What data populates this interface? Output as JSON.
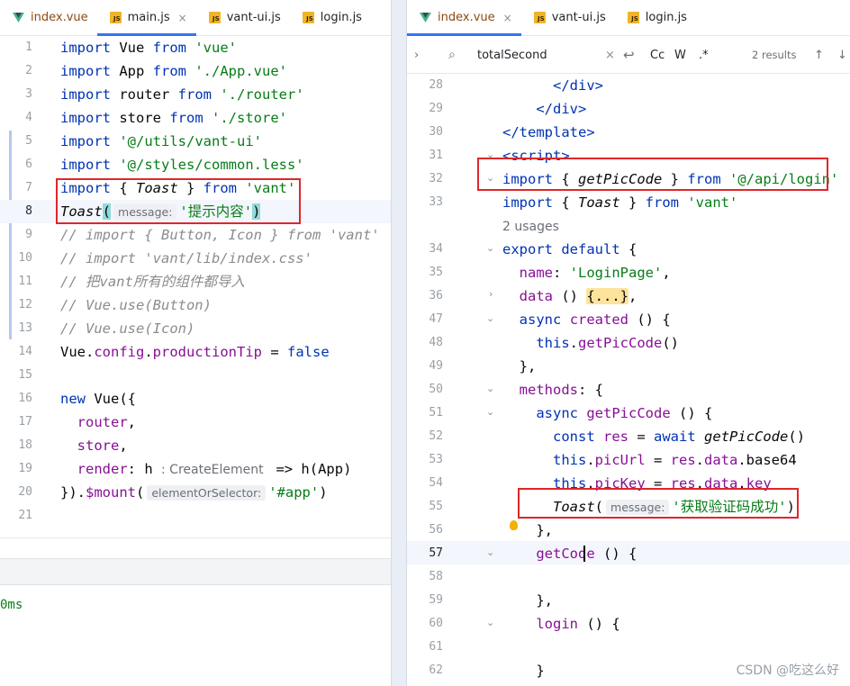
{
  "left": {
    "tabs": [
      {
        "label": "index.vue",
        "type": "vue",
        "active": false,
        "closable": false
      },
      {
        "label": "main.js",
        "type": "js",
        "active": true,
        "closable": true
      },
      {
        "label": "vant-ui.js",
        "type": "js",
        "active": false,
        "closable": false
      },
      {
        "label": "login.js",
        "type": "js",
        "active": false,
        "closable": false
      }
    ],
    "lines": [
      {
        "n": "1",
        "html": "<span class='kw'>import</span> Vue <span class='kw'>from</span> <span class='str'>'vue'</span>"
      },
      {
        "n": "2",
        "html": "<span class='kw'>import</span> App <span class='kw'>from</span> <span class='str'>'./App.vue'</span>"
      },
      {
        "n": "3",
        "html": "<span class='kw'>import</span> router <span class='kw'>from</span> <span class='str'>'./router'</span>"
      },
      {
        "n": "4",
        "html": "<span class='kw'>import</span> store <span class='kw'>from</span> <span class='str'>'./store'</span>"
      },
      {
        "n": "5",
        "html": "<span class='kw'>import</span> <span class='str'>'@/utils/vant-ui'</span>"
      },
      {
        "n": "6",
        "html": "<span class='kw'>import</span> <span class='str'>'@/styles/common.less'</span>"
      },
      {
        "n": "7",
        "html": "<span class='kw'>import</span> { <span class='fn-i'>Toast</span> } <span class='kw'>from</span> <span class='str'>'vant'</span>"
      },
      {
        "n": "8",
        "html": "<span class='fn-i'>Toast</span><span class='paren-match'>(</span><span class='hint'>message:</span><span class='str'>'提示内容'</span><span class='paren-match'>)</span>",
        "current": true
      },
      {
        "n": "9",
        "html": "<span class='cmt'>// import { Button, Icon } from 'vant'</span>"
      },
      {
        "n": "10",
        "html": "<span class='cmt'>// import 'vant/lib/index.css'</span>"
      },
      {
        "n": "11",
        "html": "<span class='cmt'>// 把vant所有的组件都导入</span>"
      },
      {
        "n": "12",
        "html": "<span class='cmt'>// Vue.use(Button)</span>"
      },
      {
        "n": "13",
        "html": "<span class='cmt'>// Vue.use(Icon)</span>"
      },
      {
        "n": "14",
        "html": "Vue.<span class='prop'>config</span>.<span class='prop'>productionTip</span> = <span class='kw'>false</span>"
      },
      {
        "n": "15",
        "html": ""
      },
      {
        "n": "16",
        "html": "<span class='kw'>new</span> Vue({"
      },
      {
        "n": "17",
        "html": "  <span class='prop'>router</span>,"
      },
      {
        "n": "18",
        "html": "  <span class='prop'>store</span>,"
      },
      {
        "n": "19",
        "html": "  <span class='prop'>render</span>: h <span class='hint-plain'>: CreateElement </span> =&gt; h(App)"
      },
      {
        "n": "20",
        "html": "}).<span class='prop'>$mount</span>(<span class='hint'>elementOrSelector:</span><span class='str'>'#app'</span>)"
      },
      {
        "n": "21",
        "html": ""
      }
    ],
    "bottom_text": "0ms"
  },
  "right": {
    "tabs": [
      {
        "label": "index.vue",
        "type": "vue",
        "active": true,
        "closable": true
      },
      {
        "label": "vant-ui.js",
        "type": "js",
        "active": false,
        "closable": false
      },
      {
        "label": "login.js",
        "type": "js",
        "active": false,
        "closable": false
      }
    ],
    "search": {
      "query": "totalSecond",
      "results": "2 results",
      "opt_case": "Cc",
      "opt_word": "W",
      "opt_regex": ".*"
    },
    "lines": [
      {
        "n": "28",
        "html": "      <span class='tag'>&lt;/div&gt;</span>"
      },
      {
        "n": "29",
        "html": "    <span class='tag'>&lt;/div&gt;</span>"
      },
      {
        "n": "30",
        "html": "<span class='tag'>&lt;/template&gt;</span>"
      },
      {
        "n": "31",
        "html": "<span class='tag'>&lt;script&gt;</span>"
      },
      {
        "n": "32",
        "html": "<span class='kw'>import</span> { <span class='fn-i'>getPicCode</span> } <span class='kw'>from</span> <span class='str'>'@/api/login'</span>"
      },
      {
        "n": "33",
        "html": "<span class='kw'>import</span> { <span class='fn-i'>Toast</span> } <span class='kw'>from</span> <span class='str'>'vant'</span>"
      },
      {
        "n": "",
        "html": "<span class='hint-plain'>2 usages</span>"
      },
      {
        "n": "34",
        "html": "<span class='kw'>export default</span> {"
      },
      {
        "n": "35",
        "html": "  <span class='prop'>name</span>: <span class='str'>'LoginPage'</span>,"
      },
      {
        "n": "36",
        "html": "  <span class='prop'>data</span> () <span class='fold-highlight'>{...}</span>,"
      },
      {
        "n": "47",
        "html": "  <span class='kw'>async</span> <span class='prop'>created</span> () {"
      },
      {
        "n": "48",
        "html": "    <span class='kw'>this</span>.<span class='prop'>getPicCode</span>()"
      },
      {
        "n": "49",
        "html": "  },"
      },
      {
        "n": "50",
        "html": "  <span class='prop'>methods</span>: {"
      },
      {
        "n": "51",
        "html": "    <span class='kw'>async</span> <span class='prop'>getPicCode</span> () {"
      },
      {
        "n": "52",
        "html": "      <span class='kw'>const</span> <span class='prop'>res</span> = <span class='kw'>await</span> <span class='fn-i'>getPicCode</span>()"
      },
      {
        "n": "53",
        "html": "      <span class='kw'>this</span>.<span class='prop'>picUrl</span> = <span class='prop'>res</span>.<span class='prop'>data</span>.base64"
      },
      {
        "n": "54",
        "html": "      <span class='kw'>this</span>.<span class='prop'>picKey</span> = <span class='prop'>res</span>.<span class='prop'>data</span>.<span class='prop'>key</span>"
      },
      {
        "n": "55",
        "html": "      <span class='fn-i'>Toast</span>(<span class='hint'>message:</span><span class='str'>'获取验证码成功'</span>)"
      },
      {
        "n": "56",
        "html": "    },"
      },
      {
        "n": "57",
        "html": "    <span class='prop'>getCode</span> () {",
        "current": true
      },
      {
        "n": "58",
        "html": ""
      },
      {
        "n": "59",
        "html": "    },"
      },
      {
        "n": "60",
        "html": "    <span class='prop'>login</span> () {"
      },
      {
        "n": "61",
        "html": ""
      },
      {
        "n": "62",
        "html": "    }"
      }
    ]
  },
  "watermark": "CSDN @吃这么好",
  "colors": {
    "red_box": "#e0262a",
    "accent": "#3574f0"
  }
}
